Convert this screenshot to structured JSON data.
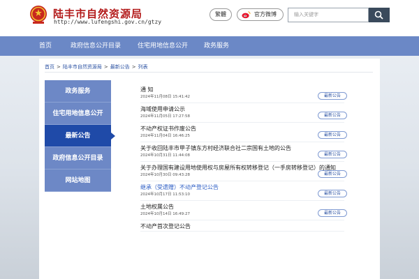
{
  "header": {
    "site_title": "陆丰市自然资源局",
    "site_url": "http://www.lufengshi.gov.cn/gtzy",
    "traditional_label": "繁體",
    "weibo_label": "官方微博",
    "search_placeholder": "输入关键字"
  },
  "nav": {
    "items": [
      {
        "label": "首页"
      },
      {
        "label": "政府信息公开目录"
      },
      {
        "label": "住宅用地信息公开"
      },
      {
        "label": "政务服务"
      }
    ]
  },
  "breadcrumb": {
    "items": [
      "首页",
      "陆丰市自然资源局",
      "最新公告",
      "列表"
    ],
    "separator": ">"
  },
  "sidebar": {
    "items": [
      {
        "label": "政务服务",
        "active": false
      },
      {
        "label": "住宅用地信息公开",
        "active": false
      },
      {
        "label": "最新公告",
        "active": true
      },
      {
        "label": "政府信息公开目录",
        "active": false
      },
      {
        "label": "网站地图",
        "active": false
      }
    ]
  },
  "list": {
    "badge_label": "最新公告",
    "items": [
      {
        "title": "通  知",
        "date": "2024年11月08日 15:41:42"
      },
      {
        "title": "海域使用申请公示",
        "date": "2024年11月05日 17:27:58"
      },
      {
        "title": "不动产权证书作废公告",
        "date": "2024年11月04日 16:46:25"
      },
      {
        "title": "关于收回陆丰市甲子镇东方村经济联合社二宗国有土地的公告",
        "date": "2024年10月31日 11:44:08"
      },
      {
        "title": "关于办理国有建设用地使用权与房屋所有权转移登记（一手房转移登记）的通知",
        "date": "2024年10月30日 09:43:28"
      },
      {
        "title": "继承（受遗赠）不动产登记公告",
        "date": "2024年10月17日 11:53:10",
        "highlight": true
      },
      {
        "title": "土地权属公告",
        "date": "2024年10月14日 16:49:27"
      },
      {
        "title": "不动产首次登记公告",
        "date": ""
      }
    ]
  },
  "colors": {
    "nav_bg": "#6b88c6",
    "sidebar_active": "#1f4aa8",
    "title_red": "#b31b1b",
    "link_blue": "#2f55a4"
  }
}
